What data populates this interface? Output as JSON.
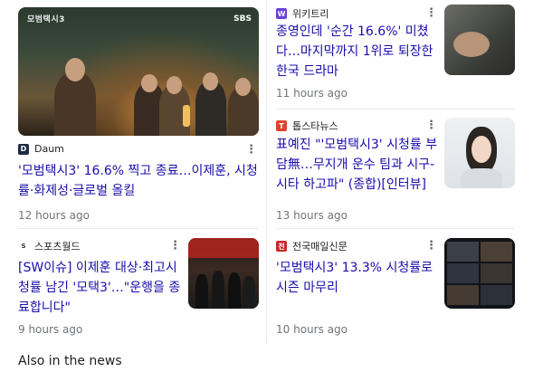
{
  "cards": [
    {
      "source": "Daum",
      "source_icon": "daum-logo-icon",
      "title": "'모범택시3' 16.6% 찍고 종료…이제훈, 시청률·화제성·글로벌 올킬",
      "time": "12 hours ago",
      "image_caption": "모범택시3",
      "image_network": "SBS"
    },
    {
      "source": "위키트리",
      "source_icon": "wikitree-logo-icon",
      "title": "종영인데 '순간 16.6%' 미쳤다…마지막까지 1위로 퇴장한 한국 드라마",
      "time": "11 hours ago"
    },
    {
      "source": "톱스타뉴스",
      "source_icon": "topstarnews-logo-icon",
      "title": "표예진 \"'모범택시3' 시청률 부담無…무지개 운수 팀과 시구-시타 하고파\" (종합)[인터뷰]",
      "time": "13 hours ago"
    },
    {
      "source": "스포츠월드",
      "source_icon": "sportsworld-logo-icon",
      "title": "[SW이슈] 이제훈 대상·최고시청률 남긴 '모택3'…\"운행을 종료합니다\"",
      "time": "9 hours ago"
    },
    {
      "source": "전국매일신문",
      "source_icon": "jeonmae-logo-icon",
      "title": "'모범택시3' 13.3% 시청률로 시즌 마무리",
      "time": "10 hours ago"
    }
  ],
  "more_icon": "more-vert-icon",
  "section_heading": "Also in the news",
  "colors": {
    "link": "#1a0dab",
    "meta": "#70757a",
    "divider": "#e8eaed"
  }
}
